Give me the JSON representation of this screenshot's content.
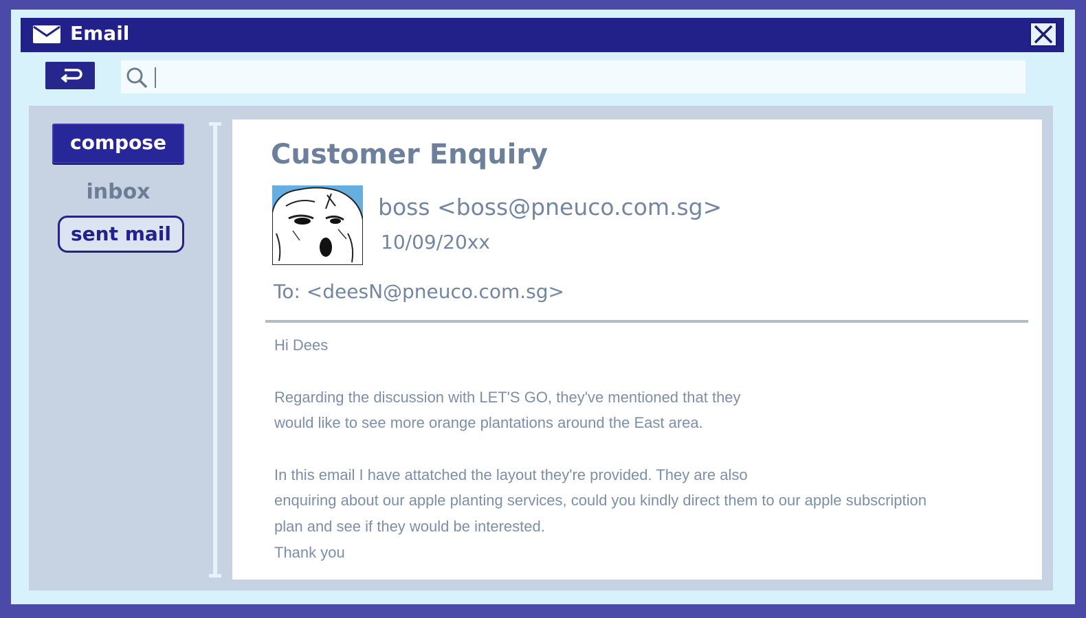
{
  "window": {
    "title": "Email",
    "title_icon": "envelope-icon",
    "close_icon": "close-icon"
  },
  "toolbar": {
    "back_icon": "return-arrow-icon",
    "search_icon": "search-icon",
    "search_value": ""
  },
  "sidebar": {
    "compose_label": "compose",
    "inbox_label": "inbox",
    "sent_label": "sent mail"
  },
  "message": {
    "subject": "Customer Enquiry",
    "sender": "boss <boss@pneuco.com.sg>",
    "date": "10/09/20xx",
    "to": "To: <deesN@pneuco.com.sg>",
    "body": [
      "Hi Dees",
      "Regarding the discussion with LET'S GO, they've mentioned that they",
      "would like to see more orange plantations around the East area.",
      "In this email I have attatched the layout they're provided. They are also",
      "enquiring about our apple planting services, could you kindly direct them to our apple subscription",
      "plan and see if they would be interested.",
      "Thank you"
    ]
  },
  "colors": {
    "frame": "#4b4aa8",
    "titlebar": "#22218a",
    "window_bg": "#d8f2fb",
    "content_bg": "#c7d3e2",
    "text_muted": "#7286a1"
  }
}
